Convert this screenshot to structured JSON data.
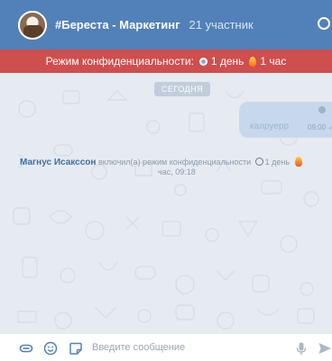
{
  "header": {
    "chat_title": "#Береста - Маркетинг",
    "members": "21 участник"
  },
  "privacy_banner": {
    "label": "Режим конфиденциальности:",
    "timer_1": "1 день",
    "timer_2": "1 час"
  },
  "chat": {
    "day_separator": "СЕГОДНЯ",
    "outgoing_message": {
      "text": "калруерр",
      "time": "09:00"
    },
    "system_message": {
      "author": "Магнус Исакссон",
      "text": "включил(а) режим конфиденциальности",
      "timer_1": "1 день",
      "timer_2_tail": "час",
      "time": ", 09:18"
    }
  },
  "composer": {
    "placeholder": "Введите сообщение"
  },
  "colors": {
    "header": "#5181b8",
    "privacy_banner": "#cf4e4e",
    "chat_background": "#e6ebf1",
    "author_name": "#3d6ea8"
  }
}
